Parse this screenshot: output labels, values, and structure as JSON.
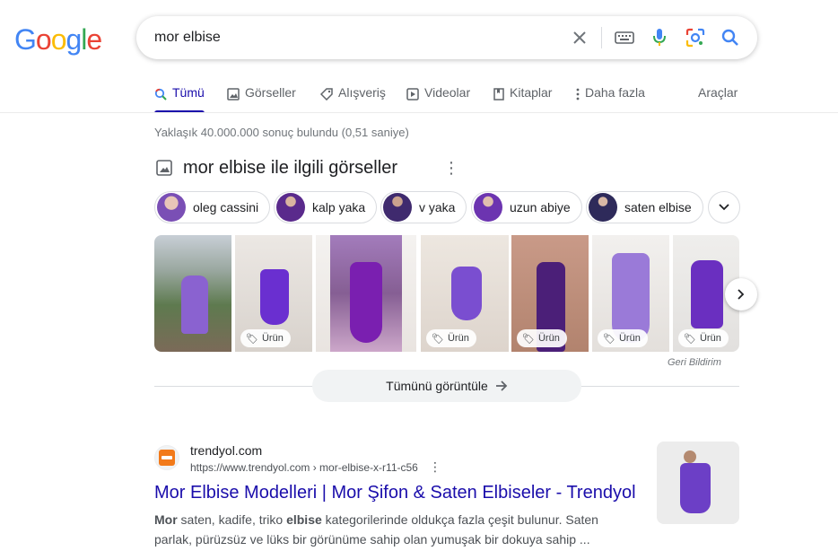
{
  "logo": {
    "text": "Google",
    "letters": [
      "G",
      "o",
      "o",
      "g",
      "l",
      "e"
    ],
    "colors": [
      "#4285F4",
      "#EA4335",
      "#FBBC05",
      "#4285F4",
      "#34A853",
      "#EA4335"
    ]
  },
  "search": {
    "query": "mor elbise",
    "icons": [
      "close-icon",
      "keyboard-icon",
      "mic-icon",
      "lens-icon",
      "search-icon"
    ]
  },
  "tabs": [
    {
      "label": "Tümü",
      "icon": "search-icon",
      "active": true
    },
    {
      "label": "Görseller",
      "icon": "image-icon"
    },
    {
      "label": "Alışveriş",
      "icon": "tag-icon"
    },
    {
      "label": "Videolar",
      "icon": "play-icon"
    },
    {
      "label": "Kitaplar",
      "icon": "book-icon"
    },
    {
      "label": "Daha fazla",
      "icon": "more-vert-icon"
    }
  ],
  "tools_label": "Araçlar",
  "stats": "Yaklaşık 40.000.000 sonuç bulundu (0,51 saniye)",
  "images_section": {
    "title": "mor elbise ile ilgili görseller",
    "chips": [
      "oleg cassini",
      "kalp yaka",
      "v yaka",
      "uzun abiye",
      "saten elbise"
    ],
    "product_badge": "Ürün",
    "feedback": "Geri Bildirim",
    "view_all": "Tümünü görüntüle"
  },
  "result": {
    "site_name": "trendyol.com",
    "url": "https://www.trendyol.com › mor-elbise-x-r11-c56",
    "title": "Mor Elbise Modelleri | Mor Şifon & Saten Elbiseler - Trendyol",
    "snippet_b1": "Mor",
    "snippet_t1": " saten, kadife, triko ",
    "snippet_b2": "elbise",
    "snippet_t2": " kategorilerinde oldukça fazla çeşit bulunur. Saten parlak, pürüzsüz ve lüks bir görünüme sahip olan yumuşak bir dokuya sahip ..."
  },
  "colors": {
    "accent": "#1a0dab",
    "purple": "#6a3bc0",
    "trendyol": "#f27a1a"
  }
}
